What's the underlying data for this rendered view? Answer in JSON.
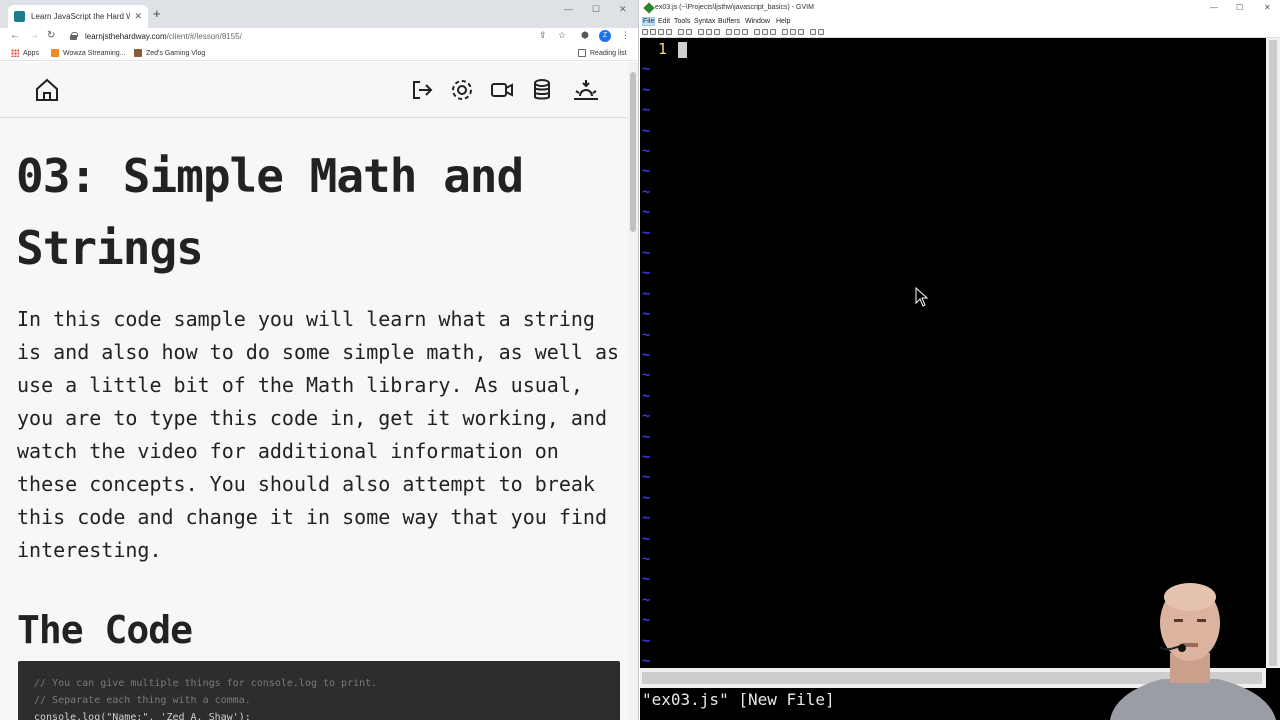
{
  "browser": {
    "tab": {
      "title": "Learn JavaScript the Hard Way",
      "close_glyph": "✕"
    },
    "newtab_glyph": "+",
    "window_controls": [
      "—",
      "☐",
      "✕"
    ],
    "nav": {
      "back": "←",
      "forward": "→",
      "reload": "↻"
    },
    "address": {
      "host": "learnjsthehardway.com",
      "path": "/client/#/lesson/8155/"
    },
    "toolbar_icons": {
      "share": "⇪",
      "star": "☆",
      "extensions": "⬢",
      "menu": "⋮"
    },
    "profile_initial": "Z",
    "bookmarks": [
      {
        "label": "Apps",
        "icon": "apps-icon"
      },
      {
        "label": "Wowza Streaming...",
        "icon": "wowza-icon"
      },
      {
        "label": "Zed's Gaming Vlog",
        "icon": "vlog-icon"
      }
    ],
    "reading_list": "Reading list"
  },
  "site": {
    "nav_icons": [
      "home-icon",
      "logout-icon",
      "settings-icon",
      "video-icon",
      "database-icon",
      "theme-sun-icon"
    ]
  },
  "lesson": {
    "title_line1": "03: Simple Math and",
    "title_line2": "Strings",
    "intro": "In this code sample you will learn what a string is and also how to do some simple math, as well as use a little bit of the Math library. As usual, you are to type this code in, get it working, and watch the video for additional information on these concepts. You should also attempt to break this code and change it in some way that you find interesting.",
    "code_heading": "The Code",
    "code_lines": [
      "// You can give multiple things for console.log to print.",
      "// Separate each thing with a comma.",
      "console.log(\"Name:\", 'Zed A. Shaw');"
    ]
  },
  "gvim": {
    "title": "ex03.js (~\\Projects\\ljsthw\\javascript_basics) - GVIM",
    "window_controls": [
      "—",
      "☐",
      "✕"
    ],
    "menu": [
      "File",
      "Edit",
      "Tools",
      "Syntax",
      "Buffers",
      "Window",
      "Help"
    ],
    "line_number": "1",
    "tilde": "~",
    "status_message": "\"ex03.js\" [New File]"
  },
  "colors": {
    "vim_line_number": "#f5d76e",
    "vim_tilde": "#3a3ae8",
    "page_bg": "#f6f8f8",
    "code_bg": "#2d2d2d"
  }
}
